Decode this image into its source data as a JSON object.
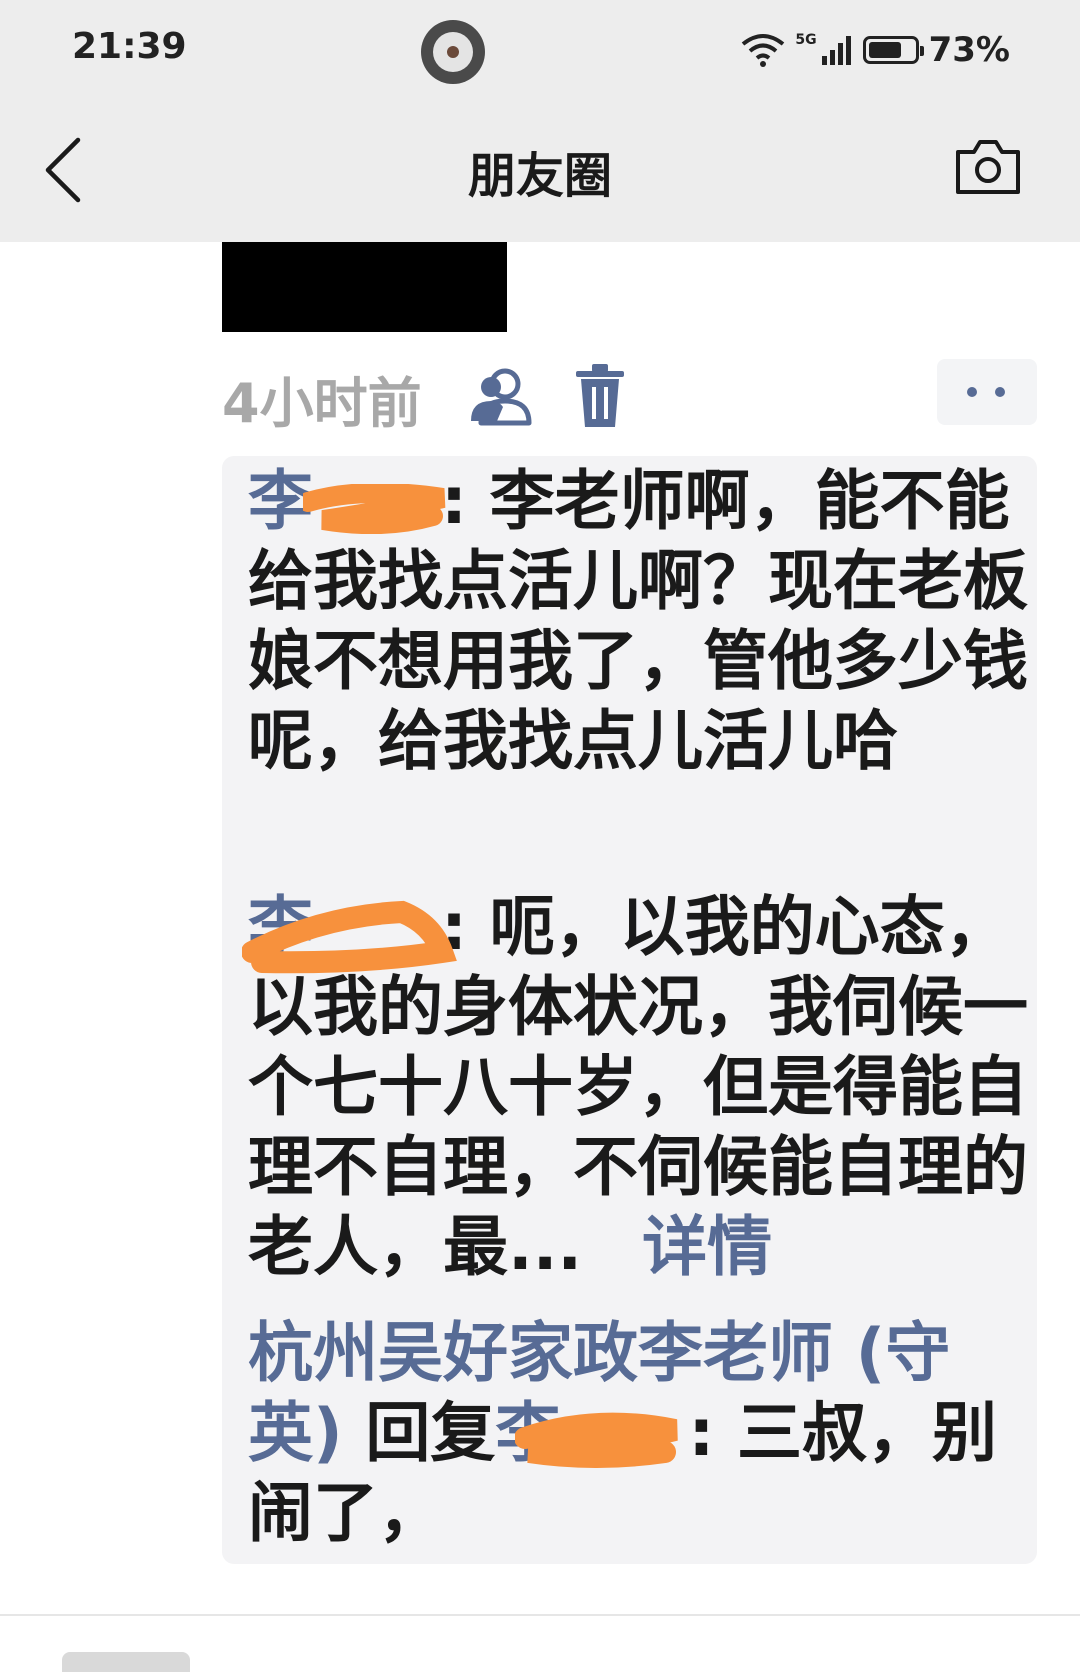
{
  "status_bar": {
    "time": "21:39",
    "network": "5G",
    "battery_percent": "73%",
    "battery_level": 0.73
  },
  "nav": {
    "title": "朋友圈",
    "back_icon": "chevron-left-icon",
    "camera_icon": "camera-icon"
  },
  "post": {
    "time_ago": "4小时前",
    "visibility_icon": "contacts-icon",
    "delete_icon": "trash-icon",
    "more_icon": "more-dots-icon"
  },
  "comments": [
    {
      "name": "李",
      "separator": ":",
      "text": " 李老师啊，能不能给我找点活儿啊？现在老板娘不想用我了，管他多少钱呢，给我找点儿活儿哈"
    },
    {
      "name": "李",
      "separator": ":",
      "text": " 呃，以我的心态，以我的身体状况，我伺候一个七十八十岁，但是得能自理不自理，不伺候能自理的老人，最...",
      "detail_link": "详情"
    },
    {
      "name": "杭州吴好家政李老师 (守英)",
      "reply_word": " 回复",
      "reply_to": "李",
      "separator": ":",
      "text": " 三叔，别闹了，"
    }
  ],
  "colors": {
    "link_blue": "#576b95",
    "redaction_orange": "#f7913d",
    "header_gray": "#ededed",
    "comment_bg": "#f3f3f5"
  }
}
